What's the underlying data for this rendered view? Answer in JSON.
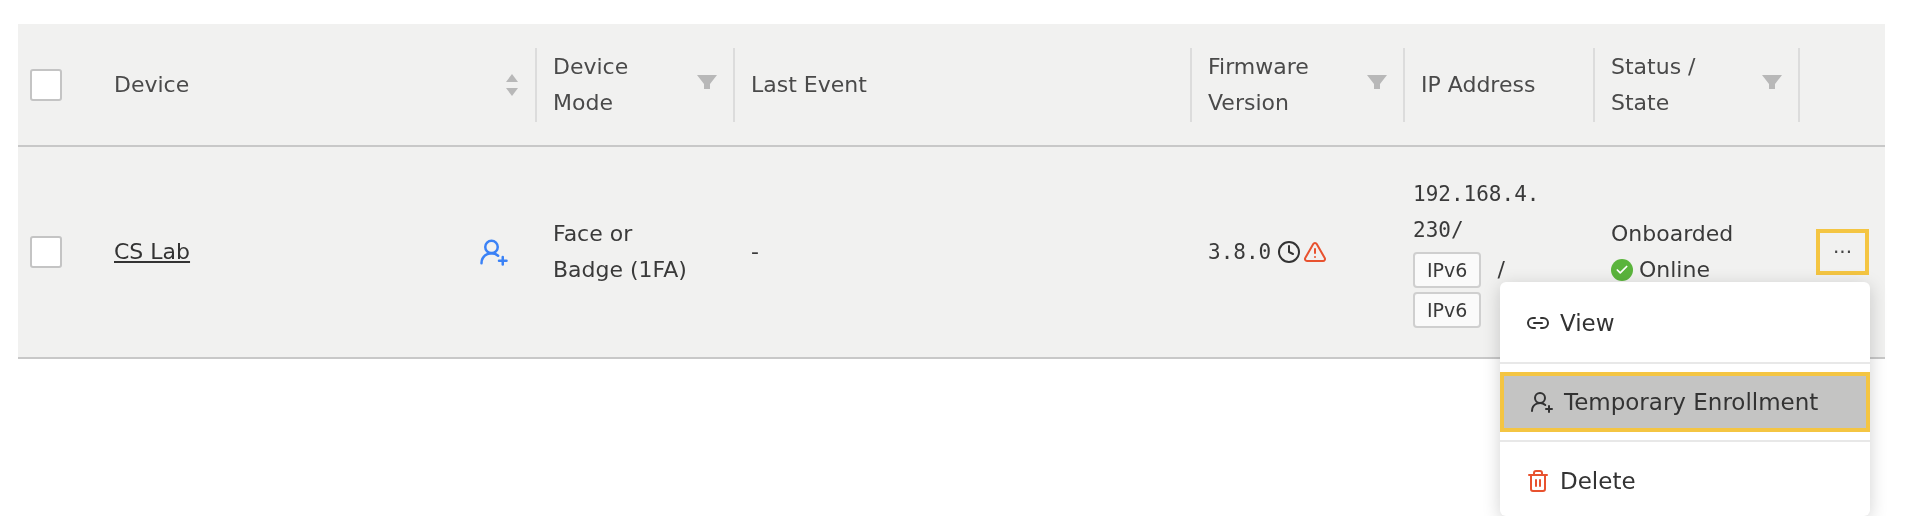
{
  "table": {
    "select_all": {
      "checked": false
    },
    "columns": [
      {
        "label": "Device",
        "kind": "sort"
      },
      {
        "label": "Device Mode",
        "kind": "filter"
      },
      {
        "label": "Last Event",
        "kind": "plain"
      },
      {
        "label": "Firmware Version",
        "kind": "filter"
      },
      {
        "label": "IP Address",
        "kind": "plain"
      },
      {
        "label": "Status / State",
        "kind": "filter"
      }
    ],
    "rows": [
      {
        "checked": false,
        "device": "CS Lab",
        "mode": "Face or Badge (1FA)",
        "last_event": "-",
        "firmware": "3.8.0",
        "ip": "192.168.4.230/",
        "ip_tags": [
          "IPv6",
          "IPv6"
        ],
        "separator": "/",
        "status": "Onboarded",
        "state": "Online",
        "actions": "···"
      }
    ]
  },
  "menu": {
    "items": [
      {
        "label": "View",
        "kind": "link",
        "selected": false
      },
      {
        "label": "Temporary Enrollment",
        "kind": "enroll",
        "selected": true
      },
      {
        "label": "Delete",
        "kind": "delete",
        "selected": false
      }
    ]
  }
}
